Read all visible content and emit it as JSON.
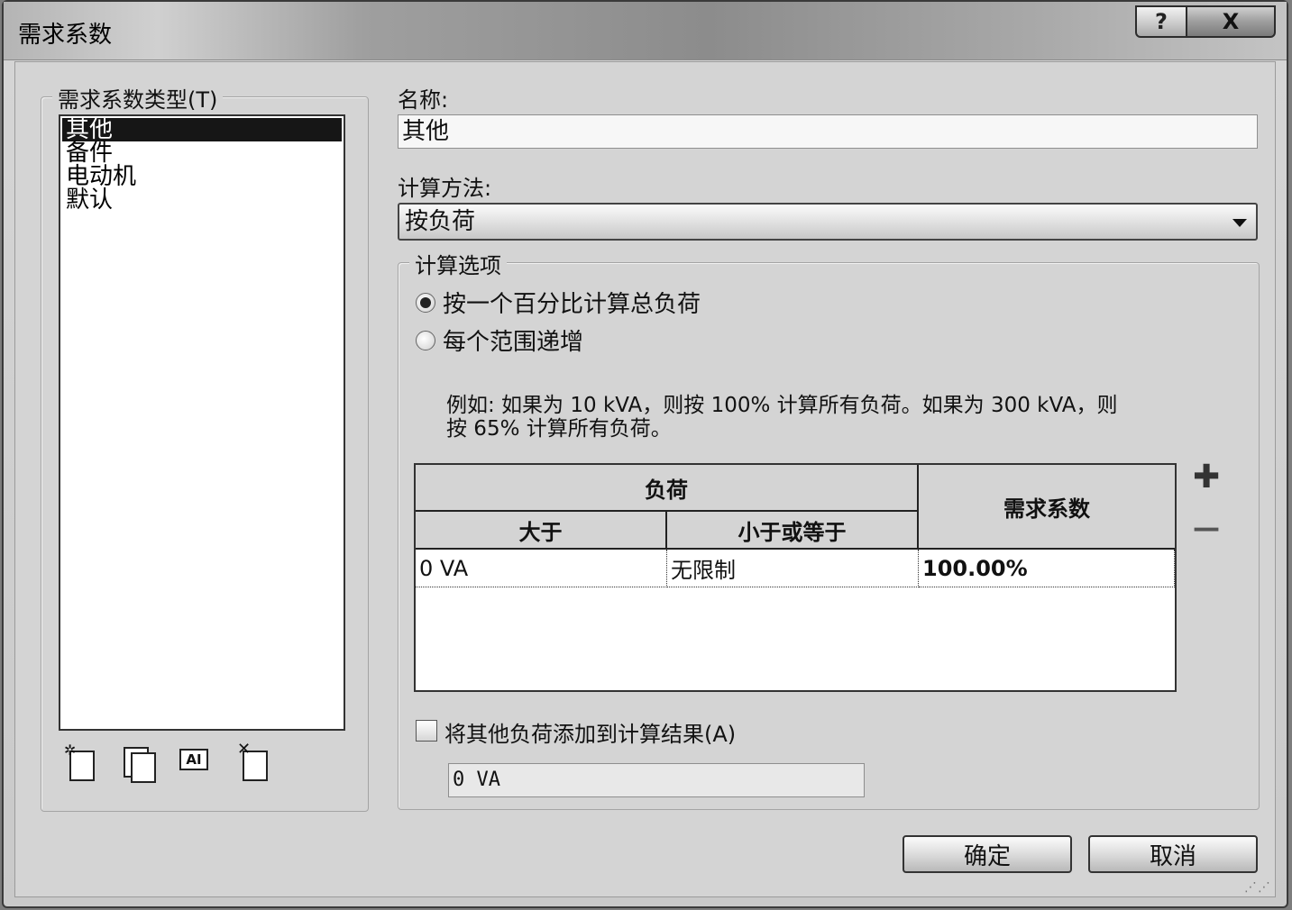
{
  "window": {
    "title": "需求系数",
    "help_label": "?",
    "close_label": "X"
  },
  "left": {
    "group_label": "需求系数类型(T)",
    "items": [
      "其他",
      "备件",
      "电动机",
      "默认"
    ],
    "selected_index": 0,
    "tools": [
      {
        "icon": "new-type-icon"
      },
      {
        "icon": "duplicate-type-icon"
      },
      {
        "icon": "rename-type-icon",
        "text": "AI"
      },
      {
        "icon": "delete-type-icon"
      }
    ]
  },
  "right": {
    "name_label": "名称:",
    "name_value": "其他",
    "method_label": "计算方法:",
    "method_value": "按负荷",
    "options_group_label": "计算选项",
    "radio_percent": "按一个百分比计算总负荷",
    "radio_incremental": "每个范围递增",
    "example_line1": "例如: 如果为 10 kVA，则按 100% 计算所有负荷。如果为 300 kVA，则",
    "example_line2": "按 65% 计算所有负荷。",
    "table": {
      "group_header": "负荷",
      "col_greater": "大于",
      "col_less_equal": "小于或等于",
      "col_factor": "需求系数",
      "rows": [
        {
          "greater": "0 VA",
          "less_equal": "无限制",
          "factor": "100.00%"
        }
      ]
    },
    "add_label": "✚",
    "remove_label": "—",
    "add_other_label": "将其他负荷添加到计算结果(A)",
    "other_value": "0 VA"
  },
  "footer": {
    "ok_label": "确定",
    "cancel_label": "取消"
  }
}
